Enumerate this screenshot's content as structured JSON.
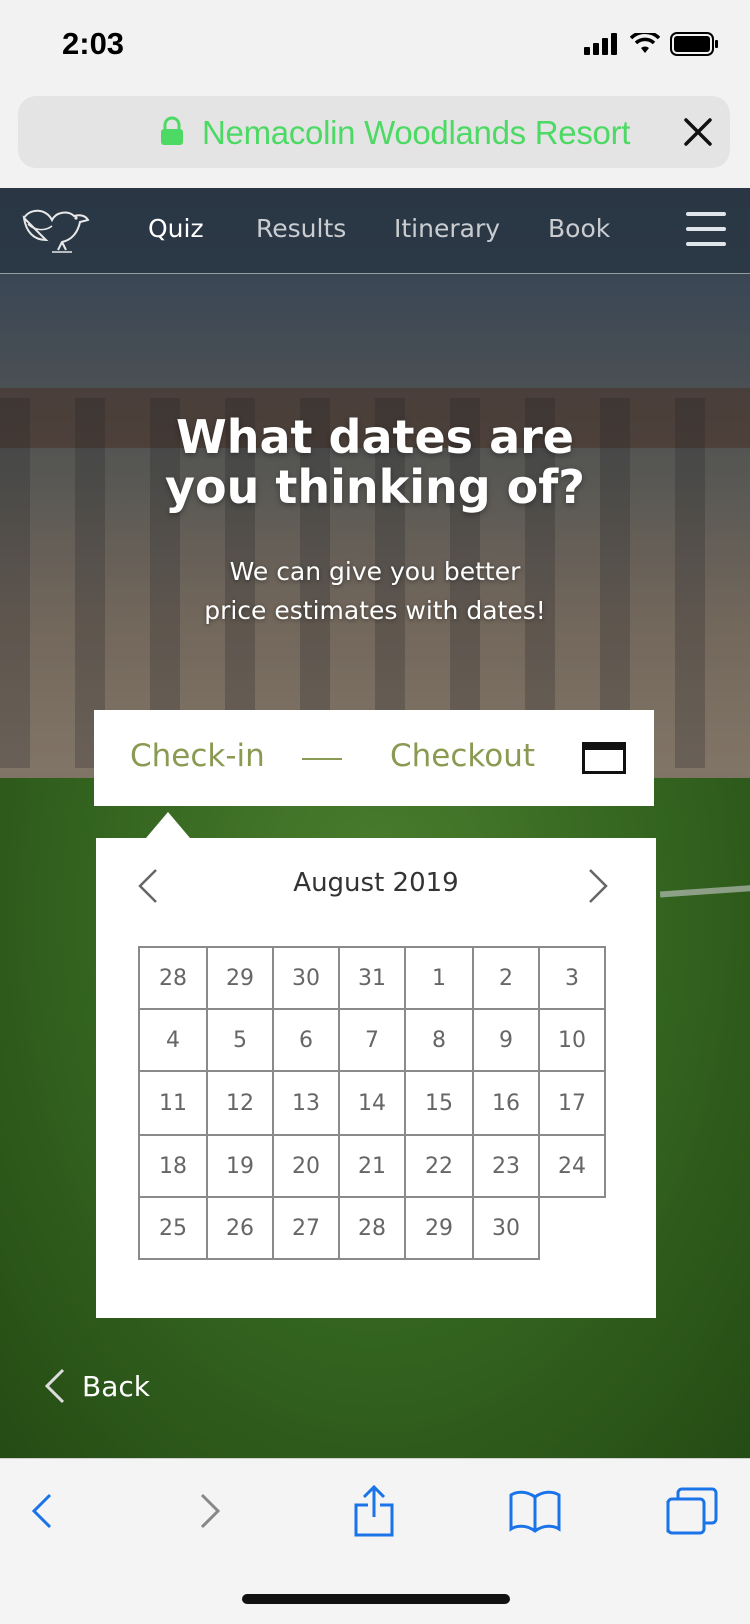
{
  "status_bar": {
    "time": "2:03"
  },
  "url_bar": {
    "site_name": "Nemacolin Woodlands Resort"
  },
  "nav": {
    "items": [
      {
        "label": "Quiz",
        "active": true
      },
      {
        "label": "Results",
        "active": false
      },
      {
        "label": "Itinerary",
        "active": false
      },
      {
        "label": "Book",
        "active": false
      }
    ]
  },
  "hero": {
    "heading_line1": "What dates are",
    "heading_line2": "you thinking of?",
    "subheading_line1": "We can give you better",
    "subheading_line2": "price estimates with dates!"
  },
  "date_field": {
    "checkin_placeholder": "Check-in",
    "checkout_placeholder": "Checkout"
  },
  "calendar": {
    "month": "August 2019",
    "weeks": [
      [
        "28",
        "29",
        "30",
        "31",
        "1",
        "2",
        "3"
      ],
      [
        "4",
        "5",
        "6",
        "7",
        "8",
        "9",
        "10"
      ],
      [
        "11",
        "12",
        "13",
        "14",
        "15",
        "16",
        "17"
      ],
      [
        "18",
        "19",
        "20",
        "21",
        "22",
        "23",
        "24"
      ],
      [
        "25",
        "26",
        "27",
        "28",
        "29",
        "30"
      ]
    ]
  },
  "footer": {
    "back_label": "Back"
  },
  "colors": {
    "accent_green": "#8a9a52",
    "url_green": "#4cd964",
    "safari_blue": "#1a73e8"
  },
  "icons": [
    "lock-icon",
    "close-icon",
    "bird-logo-icon",
    "hamburger-menu-icon",
    "calendar-icon",
    "chevron-left-icon",
    "chevron-right-icon",
    "back-chevron-icon",
    "share-icon",
    "bookmarks-icon",
    "tabs-icon"
  ]
}
